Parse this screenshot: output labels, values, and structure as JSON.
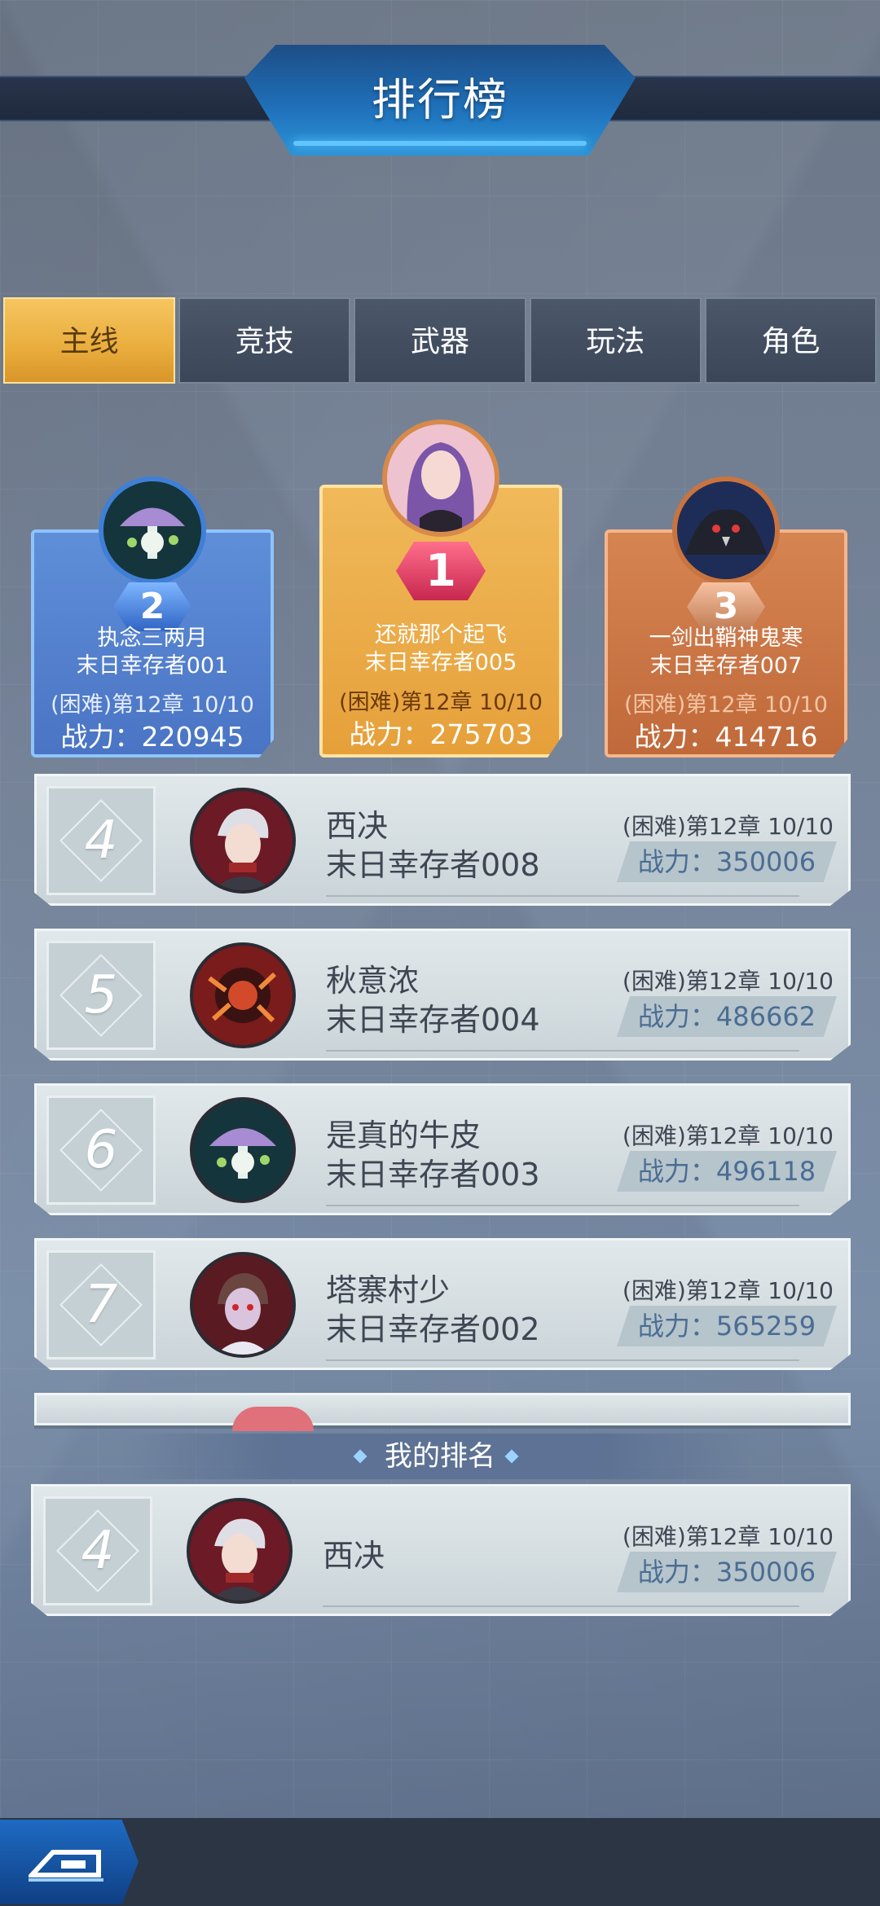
{
  "header": {
    "title": "排行榜"
  },
  "tabs": [
    {
      "label": "主线",
      "active": true
    },
    {
      "label": "竞技",
      "active": false
    },
    {
      "label": "武器",
      "active": false
    },
    {
      "label": "玩法",
      "active": false
    },
    {
      "label": "角色",
      "active": false
    }
  ],
  "podium": {
    "first": {
      "rank": "1",
      "name": "还就那个起飞",
      "sub": "末日幸存者005",
      "chapter": "(困难)第12章 10/10",
      "power_label": "战力：",
      "power": "275703"
    },
    "second": {
      "rank": "2",
      "name": "执念三两月",
      "sub": "末日幸存者001",
      "chapter": "(困难)第12章 10/10",
      "power_label": "战力：",
      "power": "220945"
    },
    "third": {
      "rank": "3",
      "name": "一剑出鞘神鬼寒",
      "sub": "末日幸存者007",
      "chapter": "(困难)第12章 10/10",
      "power_label": "战力：",
      "power": "414716"
    }
  },
  "rows": [
    {
      "rank": "4",
      "name": "西决",
      "sub": "末日幸存者008",
      "chapter": "(困难)第12章 10/10",
      "power_label": "战力：",
      "power": "350006"
    },
    {
      "rank": "5",
      "name": "秋意浓",
      "sub": "末日幸存者004",
      "chapter": "(困难)第12章 10/10",
      "power_label": "战力：",
      "power": "486662"
    },
    {
      "rank": "6",
      "name": "是真的牛皮",
      "sub": "末日幸存者003",
      "chapter": "(困难)第12章 10/10",
      "power_label": "战力：",
      "power": "496118"
    },
    {
      "rank": "7",
      "name": "塔寨村少",
      "sub": "末日幸存者002",
      "chapter": "(困难)第12章 10/10",
      "power_label": "战力：",
      "power": "565259"
    }
  ],
  "my_rank": {
    "label": "我的排名",
    "rank": "4",
    "name": "西决",
    "chapter": "(困难)第12章 10/10",
    "power_label": "战力：",
    "power": "350006"
  },
  "colors": {
    "gold": "#e9ad3c",
    "silver_blue": "#3f7fd6",
    "bronze": "#c9743f",
    "power_text": "#4a6d94"
  }
}
